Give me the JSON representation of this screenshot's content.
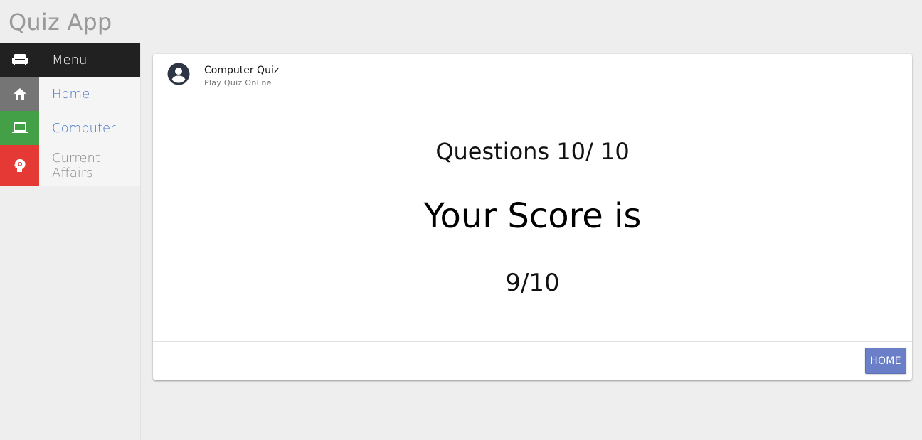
{
  "app": {
    "title": "Quiz App"
  },
  "sidebar": {
    "items": [
      {
        "label": "Menu",
        "icon": "sofa-icon"
      },
      {
        "label": "Home",
        "icon": "home-icon"
      },
      {
        "label": "Computer",
        "icon": "laptop-icon"
      },
      {
        "label": "Current Affairs",
        "icon": "head-gear-icon"
      }
    ]
  },
  "card": {
    "header": {
      "title": "Computer Quiz",
      "subtitle": "Play Quiz Online",
      "avatar_icon": "account-circle-icon"
    },
    "question_count": "Questions 10/ 10",
    "score_heading": "Your Score is",
    "score_value": "9/10",
    "home_button": "HOME"
  },
  "colors": {
    "menu_bg": "#212121",
    "home_icon_bg": "#757575",
    "computer_icon_bg": "#43a047",
    "affairs_icon_bg": "#e53935",
    "link": "#4a78c8",
    "button": "#6b7fc8"
  }
}
